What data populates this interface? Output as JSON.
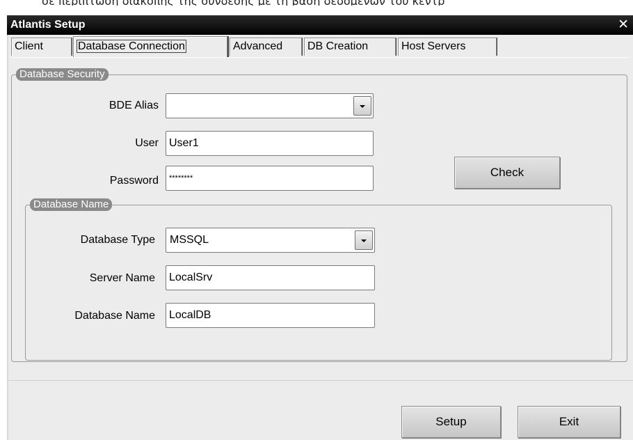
{
  "background_text": "σε περίπτωση διακοπής της σύνδεσης με τη βάση δεδομένων του κεντρ",
  "window": {
    "title": "Atlantis Setup",
    "close_glyph": "✕"
  },
  "tabs": [
    {
      "label": "Client",
      "active": false
    },
    {
      "label": "Database Connection",
      "active": true
    },
    {
      "label": "Advanced",
      "active": false
    },
    {
      "label": "DB Creation",
      "active": false
    },
    {
      "label": "Host Servers",
      "active": false
    }
  ],
  "security": {
    "legend": "Database Security",
    "bde_alias": {
      "label": "BDE Alias",
      "value": ""
    },
    "user": {
      "label": "User",
      "value": "User1"
    },
    "password": {
      "label": "Password",
      "value": "********"
    },
    "check_label": "Check"
  },
  "dbname": {
    "legend": "Database Name",
    "type": {
      "label": "Database Type",
      "value": "MSSQL"
    },
    "server": {
      "label": "Server Name",
      "value": "LocalSrv"
    },
    "database": {
      "label": "Database Name",
      "value": "LocalDB"
    }
  },
  "footer": {
    "setup_label": "Setup",
    "exit_label": "Exit"
  },
  "icons": {
    "dropdown": "dropdown-arrow-icon",
    "close": "close-icon"
  },
  "colors": {
    "titlebar": "#000000",
    "dialog_bg": "#ececec",
    "legend_bg": "#8a8a8a"
  }
}
